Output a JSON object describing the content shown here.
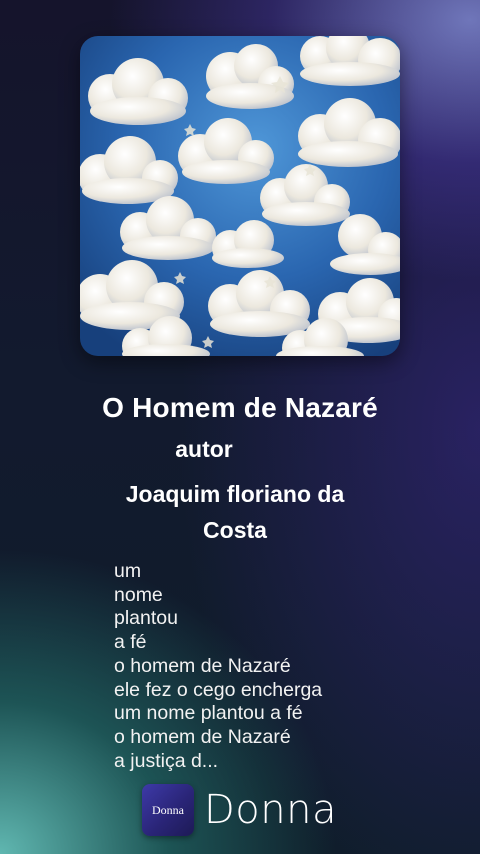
{
  "track": {
    "title": "O Homem de Nazaré",
    "author_label": "autor",
    "author_name_line1": "Joaquim floriano da",
    "author_name_line2": "Costa"
  },
  "lyrics": [
    "um",
    "nome",
    "plantou",
    "a fé",
    "o homem de Nazaré",
    "ele fez o cego encherga",
    "um nome plantou a fé",
    "o homem de Nazaré",
    "a justiça d..."
  ],
  "brand": {
    "icon_text": "Donna",
    "name": "Donna"
  },
  "cover": {
    "icon": "cloud-sky-artwork",
    "colors": {
      "sky": "#2f6fb8",
      "cloud": "#f4f1ea"
    }
  }
}
